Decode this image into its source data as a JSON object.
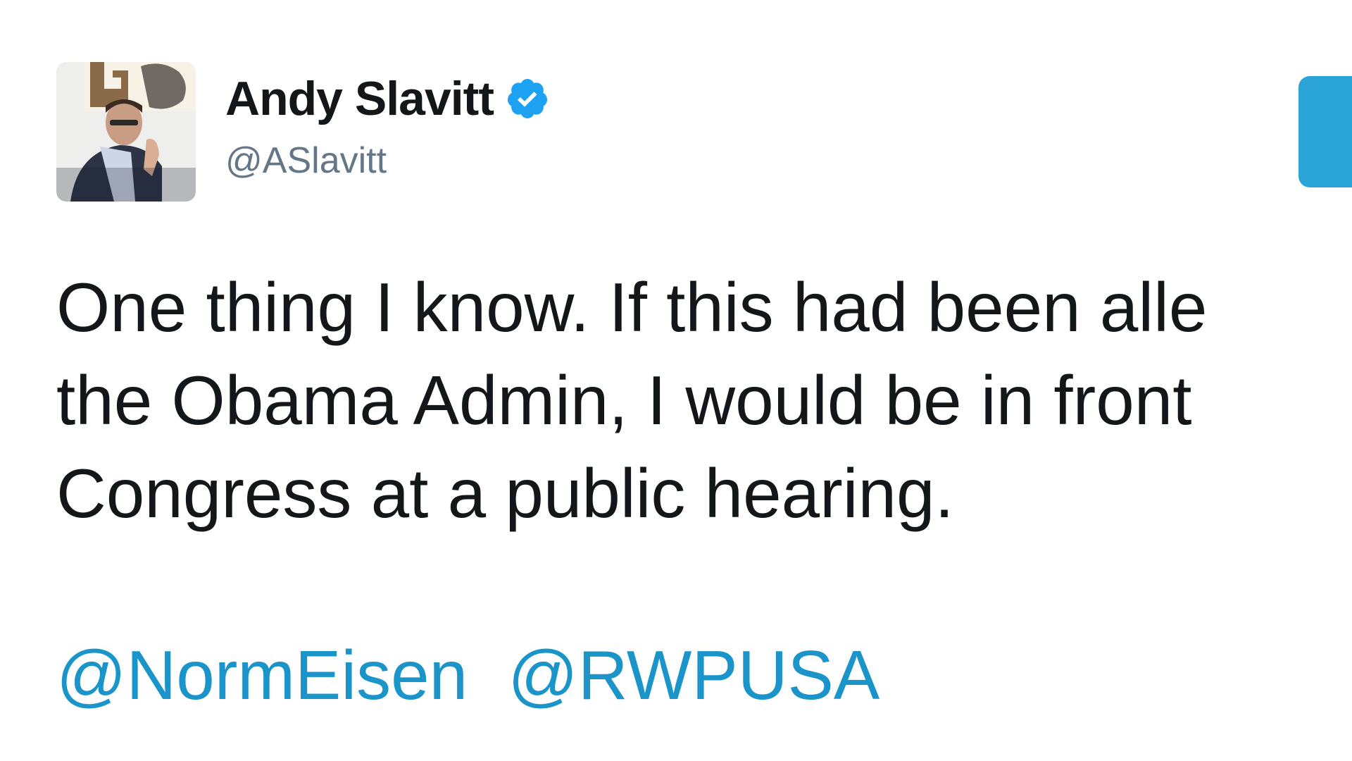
{
  "author": {
    "display_name": "Andy Slavitt",
    "handle": "@ASlavitt",
    "verified": true,
    "avatar_icon": "profile-photo"
  },
  "follow_button": {
    "color": "#2aa3d6"
  },
  "tweet": {
    "lines": [
      "One thing I know. If this had been alle",
      "the Obama Admin, I would be in front",
      "Congress at a public hearing."
    ],
    "mentions": [
      "@NormEisen",
      "@RWPUSA"
    ]
  },
  "colors": {
    "name": "#14171a",
    "handle": "#657786",
    "link": "#1b95c9",
    "verified_badge": "#1da1f2"
  }
}
